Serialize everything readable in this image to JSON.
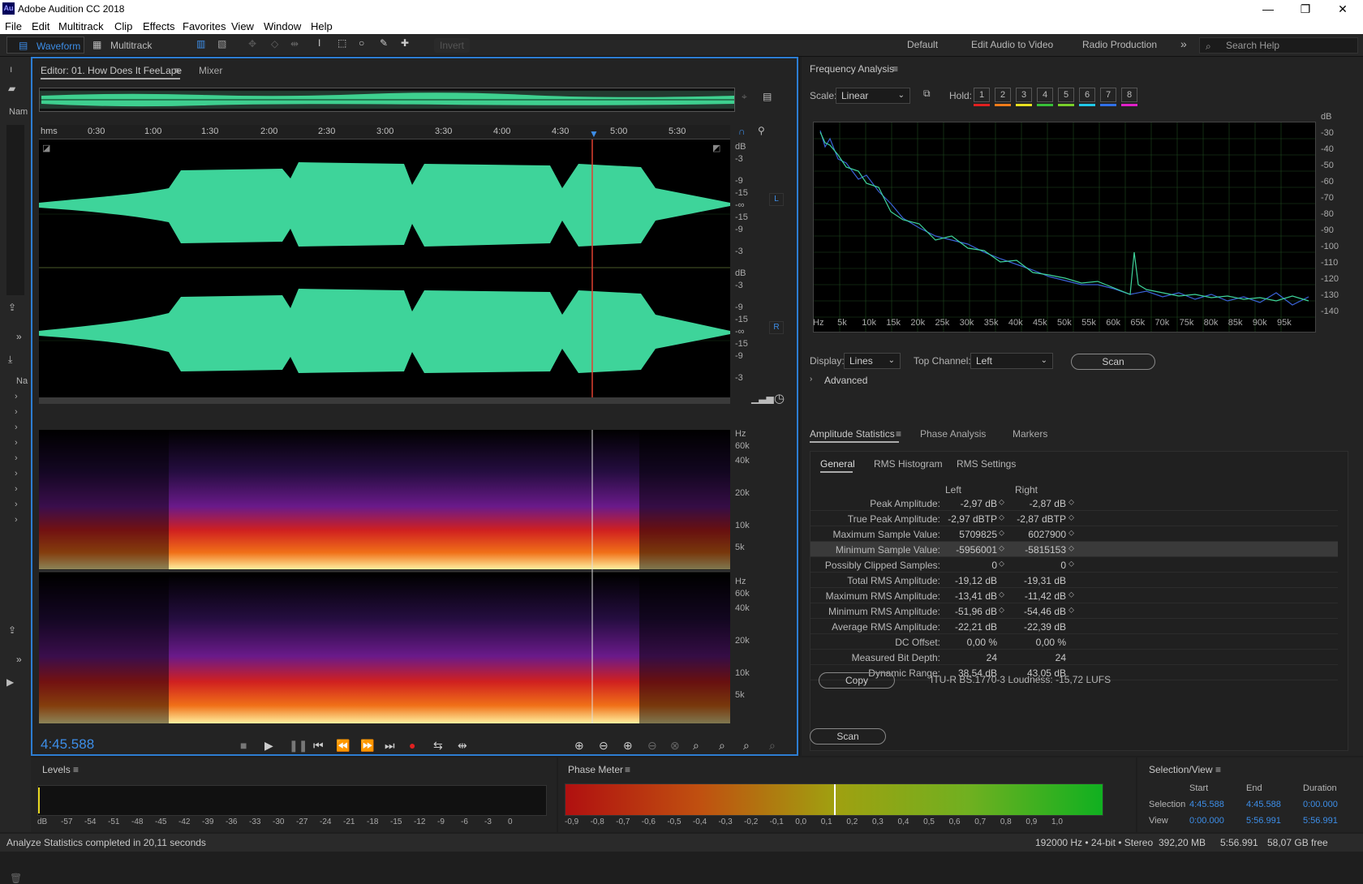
{
  "app": {
    "title": "Adobe Audition CC 2018",
    "logo": "Au"
  },
  "window_controls": {
    "minimize": "—",
    "restore": "❐",
    "close": "✕"
  },
  "menu": [
    "File",
    "Edit",
    "Multitrack",
    "Clip",
    "Effects",
    "Favorites",
    "View",
    "Window",
    "Help"
  ],
  "toolbar": {
    "waveform": "Waveform",
    "multitrack": "Multitrack",
    "invert": "Invert",
    "workspaces": [
      "Default",
      "Edit Audio to Video",
      "Radio Production"
    ],
    "more": "»",
    "search_placeholder": "Search Help"
  },
  "left_tools": {
    "name_label": "Nam",
    "name_label2": "Na"
  },
  "editor": {
    "tab": "Editor: 01. How Does It FeeLape",
    "mixer": "Mixer",
    "timecode": "4:45.588",
    "ruler": [
      "hms",
      "0:30",
      "1:00",
      "1:30",
      "2:00",
      "2:30",
      "3:00",
      "3:30",
      "4:00",
      "4:30",
      "5:00",
      "5:30"
    ],
    "db_left": [
      "dB",
      "-3",
      "-9",
      "-15",
      "-∞",
      "-15",
      "-9",
      "-3"
    ],
    "db_right": [
      "dB",
      "-3",
      "-9",
      "-15",
      "-∞",
      "-15",
      "-9",
      "-3"
    ],
    "ch_left": "L",
    "ch_right": "R",
    "hz_top": [
      "Hz",
      "60k",
      "40k",
      "20k",
      "10k",
      "5k"
    ],
    "hz_bottom": [
      "Hz",
      "60k",
      "40k",
      "20k",
      "10k",
      "5k"
    ],
    "playhead_fraction": 0.8
  },
  "frequency": {
    "title": "Frequency Analysis",
    "scale_label": "Scale:",
    "scale_value": "Linear",
    "hold_label": "Hold:",
    "holds": [
      "1",
      "2",
      "3",
      "4",
      "5",
      "6",
      "7",
      "8"
    ],
    "hold_colors": [
      "#e02020",
      "#f07b1a",
      "#e8e020",
      "#38c038",
      "#78d02a",
      "#20c8e8",
      "#3070e8",
      "#e020c8"
    ],
    "db_axis": [
      "dB",
      "-30",
      "-40",
      "-50",
      "-60",
      "-70",
      "-80",
      "-90",
      "-100",
      "-110",
      "-120",
      "-130",
      "-140"
    ],
    "hz_axis": [
      "Hz",
      "5k",
      "10k",
      "15k",
      "20k",
      "25k",
      "30k",
      "35k",
      "40k",
      "45k",
      "50k",
      "55k",
      "60k",
      "65k",
      "70k",
      "75k",
      "80k",
      "85k",
      "90k",
      "95k"
    ],
    "display_label": "Display:",
    "display_value": "Lines",
    "topch_label": "Top Channel:",
    "topch_value": "Left",
    "scan": "Scan",
    "advanced": "Advanced"
  },
  "amplitude": {
    "tabs": [
      "Amplitude Statistics",
      "Phase Analysis",
      "Markers"
    ],
    "subtabs": [
      "General",
      "RMS Histogram",
      "RMS Settings"
    ],
    "col_left": "Left",
    "col_right": "Right",
    "rows": [
      {
        "label": "Peak Amplitude:",
        "left": "-2,97 dB",
        "right": "-2,87 dB",
        "marker": true
      },
      {
        "label": "True Peak Amplitude:",
        "left": "-2,97 dBTP",
        "right": "-2,87 dBTP",
        "marker": true
      },
      {
        "label": "Maximum Sample Value:",
        "left": "5709825",
        "right": "6027900",
        "marker": true
      },
      {
        "label": "Minimum Sample Value:",
        "left": "-5956001",
        "right": "-5815153",
        "marker": true,
        "selected": true
      },
      {
        "label": "Possibly Clipped Samples:",
        "left": "0",
        "right": "0",
        "marker": true
      },
      {
        "label": "Total RMS Amplitude:",
        "left": "-19,12 dB",
        "right": "-19,31 dB",
        "marker": false
      },
      {
        "label": "Maximum RMS Amplitude:",
        "left": "-13,41 dB",
        "right": "-11,42 dB",
        "marker": true
      },
      {
        "label": "Minimum RMS Amplitude:",
        "left": "-51,96 dB",
        "right": "-54,46 dB",
        "marker": true
      },
      {
        "label": "Average RMS Amplitude:",
        "left": "-22,21 dB",
        "right": "-22,39 dB",
        "marker": false
      },
      {
        "label": "DC Offset:",
        "left": "0,00 %",
        "right": "0,00 %",
        "marker": false
      },
      {
        "label": "Measured Bit Depth:",
        "left": "24",
        "right": "24",
        "marker": false
      },
      {
        "label": "Dynamic Range:",
        "left": "38,54 dB",
        "right": "43,05 dB",
        "marker": false
      }
    ],
    "copy": "Copy",
    "loudness": "ITU-R BS.1770-3 Loudness: -15,72 LUFS",
    "scan": "Scan"
  },
  "levels": {
    "title": "Levels",
    "scale": [
      "dB",
      "-57",
      "-54",
      "-51",
      "-48",
      "-45",
      "-42",
      "-39",
      "-36",
      "-33",
      "-30",
      "-27",
      "-24",
      "-21",
      "-18",
      "-15",
      "-12",
      "-9",
      "-6",
      "-3",
      "0"
    ]
  },
  "phase": {
    "title": "Phase Meter",
    "scale": [
      "-0,9",
      "-0,8",
      "-0,7",
      "-0,6",
      "-0,5",
      "-0,4",
      "-0,3",
      "-0,2",
      "-0,1",
      "0,0",
      "0,1",
      "0,2",
      "0,3",
      "0,4",
      "0,5",
      "0,6",
      "0,7",
      "0,8",
      "0,9",
      "1,0"
    ]
  },
  "selview": {
    "title": "Selection/View",
    "start": "Start",
    "end": "End",
    "duration": "Duration",
    "selection": "Selection",
    "view": "View",
    "sel_start": "4:45.588",
    "sel_end": "4:45.588",
    "sel_dur": "0:00.000",
    "view_start": "0:00.000",
    "view_end": "5:56.991",
    "view_dur": "5:56.991"
  },
  "status": {
    "message": "Analyze Statistics completed in 20,11 seconds",
    "format": "192000 Hz • 24-bit • Stereo",
    "size": "392,20 MB",
    "duration": "5:56.991",
    "free": "58,07 GB free"
  }
}
